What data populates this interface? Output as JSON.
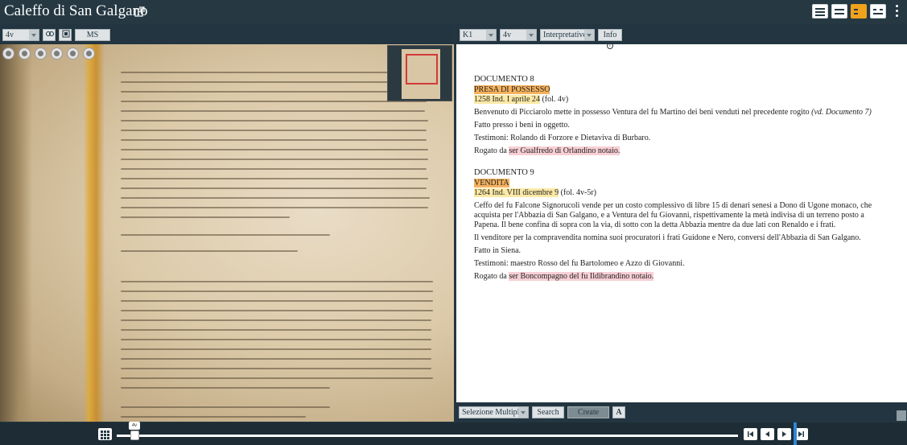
{
  "app": {
    "title": "Caleffo di San Galgano"
  },
  "left_toolbar": {
    "folio": "4v",
    "ms_desc": "MS Desc"
  },
  "right_toolbar": {
    "witness": "K1",
    "folio": "4v",
    "edition_level": "Interpretative",
    "info": "Info"
  },
  "documents": [
    {
      "heading": "DOCUMENTO 8",
      "type": "PRESA DI POSSESSO",
      "date": "1258 Ind. I aprile 24",
      "ref": " (fol. 4v)",
      "body": "Benvenuto di Picciarolo mette in possesso Ventura del fu Martino dei beni venduti nel precedente rogito ",
      "body_note": "(vd. Documento 7)",
      "place": "Fatto presso i beni in oggetto.",
      "witnesses": "Testimoni: Rolando di Forzore e Dietaviva di Burbaro.",
      "rogato_prefix": "Rogato da ",
      "notary": "ser Gualfredo di Orlandino notaio."
    },
    {
      "heading": "DOCUMENTO 9",
      "type": "VENDITA",
      "date": "1264 Ind. VIII dicembre 9",
      "ref": " (fol. 4v-5r)",
      "body": "Ceffo del fu Falcone Signorucoli vende per un costo complessivo di libre 15 di denari senesi a Dono di Ugone monaco, che acquista per l'Abbazia di San Galgano, e a Ventura del fu Giovanni, rispettivamente la metà indivisa di un terreno posto a Papena. Il bene confina di sopra con la via, di sotto con la detta Abbazia mentre da due lati con Renaldo e i frati.",
      "body2": "Il venditore per la compravendita nomina suoi procuratori i frati Guidone e Nero, conversi dell'Abbazia di San Galgano.",
      "place": "Fatto in Siena.",
      "witnesses": "Testimoni: maestro Rosso del fu Bartolomeo e Azzo di Giovanni.",
      "rogato_prefix": "Rogato da ",
      "notary": "ser Boncompagno del fu Ildibrandino notaio."
    }
  ],
  "right_footer": {
    "selection": "Selezione Multipla",
    "search": "Search",
    "create_index": "Create index"
  },
  "bottom": {
    "slider_tip": "4v"
  }
}
